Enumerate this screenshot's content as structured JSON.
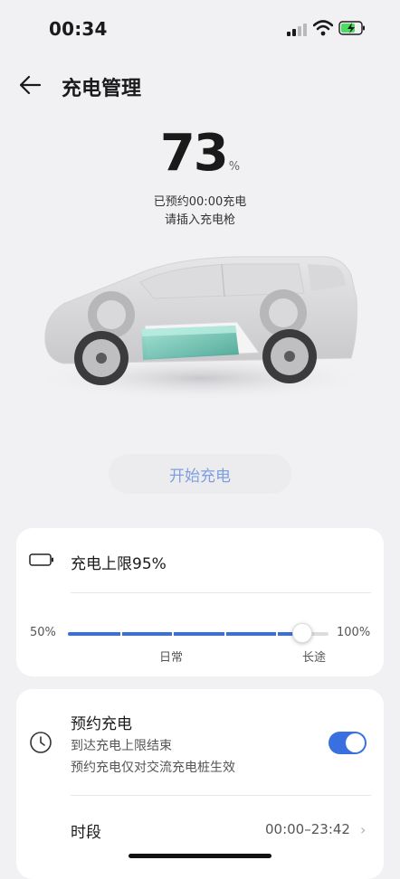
{
  "status": {
    "time": "00:34"
  },
  "header": {
    "title": "充电管理"
  },
  "charge": {
    "value": "73",
    "unit": "%",
    "line1": "已预约00:00充电",
    "line2": "请插入充电枪"
  },
  "start_button": {
    "label": "开始充电"
  },
  "limit": {
    "title": "充电上限95%",
    "min_label": "50%",
    "max_label": "100%",
    "daily_label": "日常",
    "trip_label": "长途",
    "level_percent": 95
  },
  "schedule": {
    "title": "预约充电",
    "line1": "到达充电上限结束",
    "line2": "预约充电仅对交流充电桩生效",
    "enabled": true,
    "period_label": "时段",
    "period_value": "00:00–23:42"
  },
  "colors": {
    "accent": "#3a6fe0",
    "button_text": "#7f9ee0",
    "battery_teal": "#5fc8b4"
  }
}
